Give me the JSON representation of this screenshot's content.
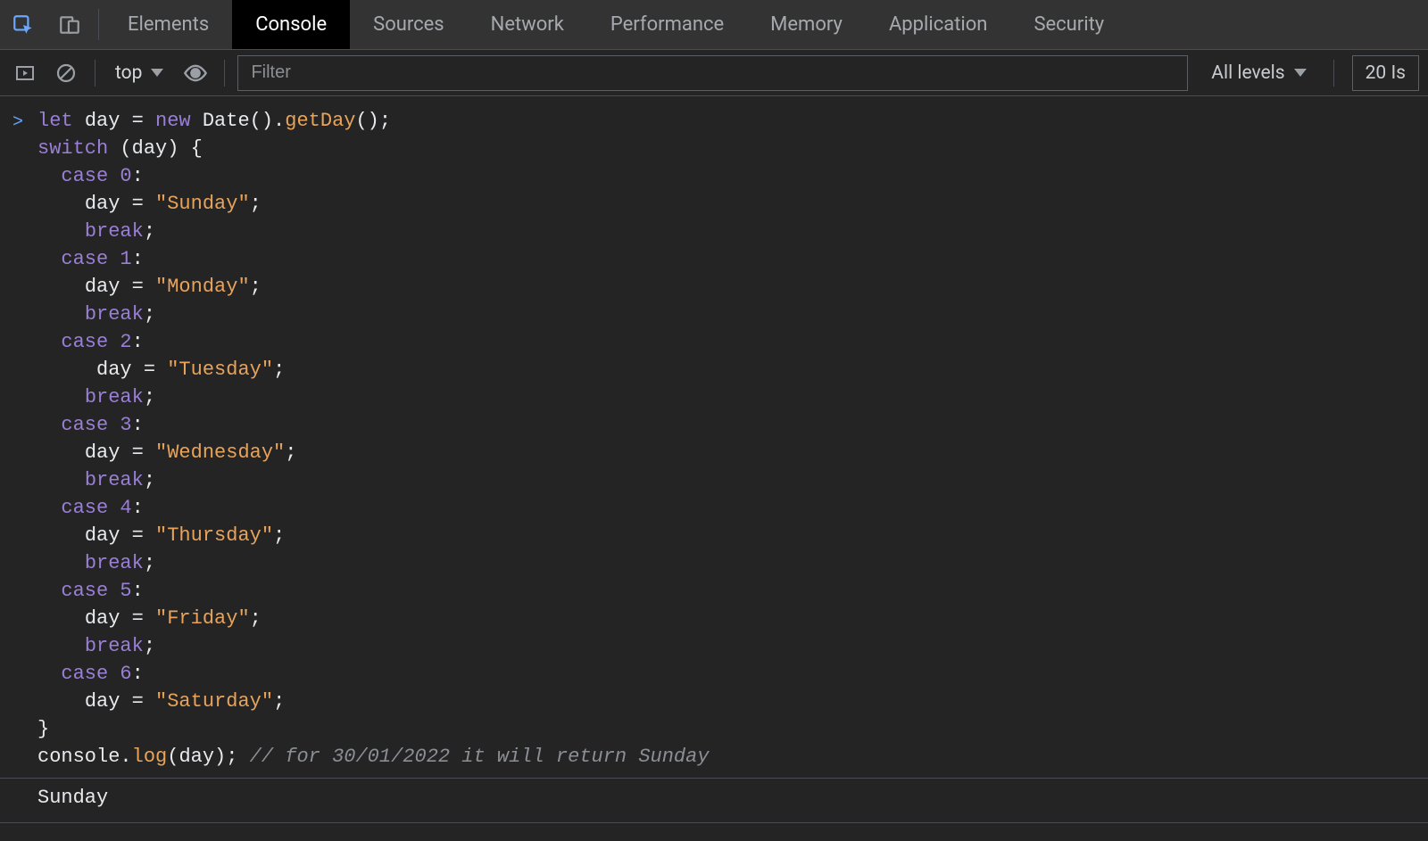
{
  "tabs": {
    "items": [
      "Elements",
      "Console",
      "Sources",
      "Network",
      "Performance",
      "Memory",
      "Application",
      "Security"
    ],
    "active_index": 1
  },
  "toolbar": {
    "context_label": "top",
    "filter_placeholder": "Filter",
    "levels_label": "All levels",
    "issues_label": "20 Is"
  },
  "console": {
    "prompt_marker": ">",
    "output": "Sunday",
    "code": {
      "line1": {
        "let": "let",
        "sp1": " ",
        "day": "day",
        "sp2": " ",
        "eq": "=",
        "sp3": " ",
        "new": "new",
        "sp4": " ",
        "Date": "Date",
        "p1": "().",
        "getDay": "getDay",
        "p2": "();"
      },
      "line2": {
        "switch": "switch",
        "sp": " (",
        "day": "day",
        "rest": ") {"
      },
      "case0": {
        "indent": "  ",
        "case": "case",
        "sp": " ",
        "n": "0",
        "colon": ":"
      },
      "asg0": {
        "indent": "    ",
        "day": "day",
        "sp1": " ",
        "eq": "=",
        "sp2": " ",
        "str": "\"Sunday\"",
        "semi": ";"
      },
      "brk0": {
        "indent": "    ",
        "break": "break",
        "semi": ";"
      },
      "case1": {
        "indent": "  ",
        "case": "case",
        "sp": " ",
        "n": "1",
        "colon": ":"
      },
      "asg1": {
        "indent": "    ",
        "day": "day",
        "sp1": " ",
        "eq": "=",
        "sp2": " ",
        "str": "\"Monday\"",
        "semi": ";"
      },
      "brk1": {
        "indent": "    ",
        "break": "break",
        "semi": ";"
      },
      "case2": {
        "indent": "  ",
        "case": "case",
        "sp": " ",
        "n": "2",
        "colon": ":"
      },
      "asg2": {
        "indent": "     ",
        "day": "day",
        "sp1": " ",
        "eq": "=",
        "sp2": " ",
        "str": "\"Tuesday\"",
        "semi": ";"
      },
      "brk2": {
        "indent": "    ",
        "break": "break",
        "semi": ";"
      },
      "case3": {
        "indent": "  ",
        "case": "case",
        "sp": " ",
        "n": "3",
        "colon": ":"
      },
      "asg3": {
        "indent": "    ",
        "day": "day",
        "sp1": " ",
        "eq": "=",
        "sp2": " ",
        "str": "\"Wednesday\"",
        "semi": ";"
      },
      "brk3": {
        "indent": "    ",
        "break": "break",
        "semi": ";"
      },
      "case4": {
        "indent": "  ",
        "case": "case",
        "sp": " ",
        "n": "4",
        "colon": ":"
      },
      "asg4": {
        "indent": "    ",
        "day": "day",
        "sp1": " ",
        "eq": "=",
        "sp2": " ",
        "str": "\"Thursday\"",
        "semi": ";"
      },
      "brk4": {
        "indent": "    ",
        "break": "break",
        "semi": ";"
      },
      "case5": {
        "indent": "  ",
        "case": "case",
        "sp": " ",
        "n": "5",
        "colon": ":"
      },
      "asg5": {
        "indent": "    ",
        "day": "day",
        "sp1": " ",
        "eq": "=",
        "sp2": " ",
        "str": "\"Friday\"",
        "semi": ";"
      },
      "brk5": {
        "indent": "    ",
        "break": "break",
        "semi": ";"
      },
      "case6": {
        "indent": "  ",
        "case": "case",
        "sp": " ",
        "n": "6",
        "colon": ":"
      },
      "asg6": {
        "indent": "    ",
        "day": "day",
        "sp1": " ",
        "eq": "=",
        "sp2": " ",
        "str": "\"Saturday\"",
        "semi": ";"
      },
      "close": {
        "brace": "}"
      },
      "log": {
        "console": "console",
        "dot": ".",
        "log": "log",
        "op": "(",
        "day": "day",
        "cp": "); ",
        "cmt": "// for 30/01/2022 it will return Sunday"
      }
    }
  }
}
